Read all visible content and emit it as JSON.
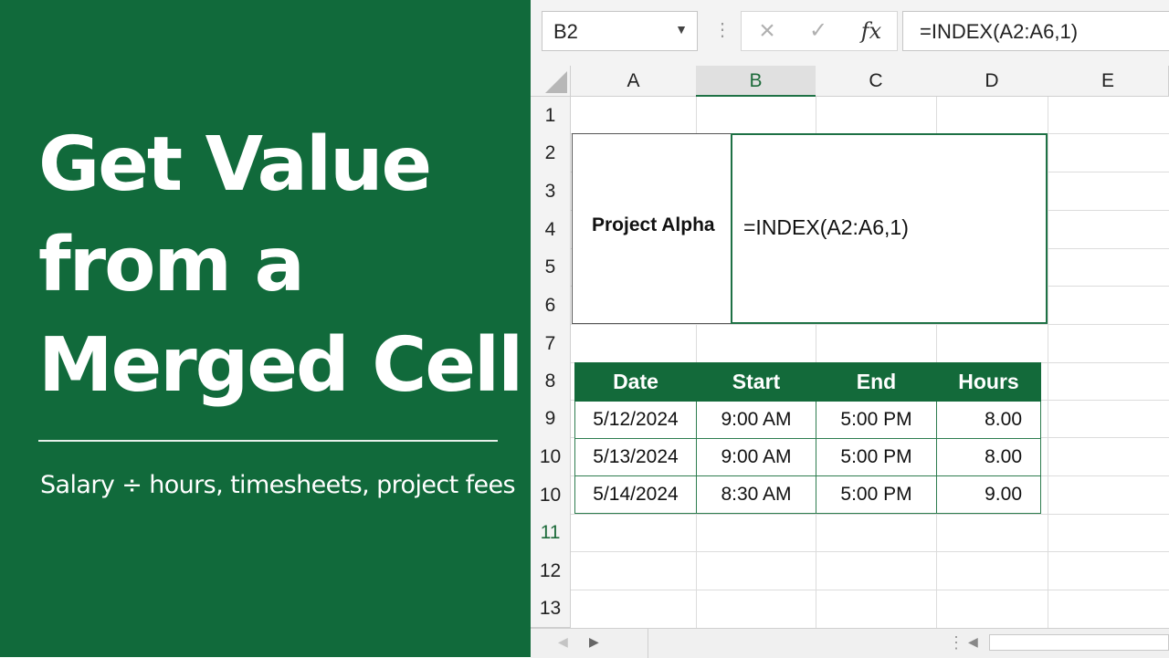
{
  "promo": {
    "title_lines": [
      "Get Value",
      "from a",
      "Merged Cell"
    ],
    "subtitle": "Salary ÷ hours, timesheets, project fees",
    "background_color": "#116a3b"
  },
  "formula_bar": {
    "name_box": "B2",
    "cancel_icon": "×",
    "enter_icon": "✓",
    "fx_label": "fx",
    "formula": "=INDEX(A2:A6,1)"
  },
  "sheet": {
    "columns": [
      "A",
      "B",
      "C",
      "D",
      "E"
    ],
    "selected_column": "B",
    "rows": [
      "1",
      "2",
      "3",
      "4",
      "5",
      "6",
      "7",
      "8",
      "9",
      "10",
      "10",
      "11",
      "12",
      "13"
    ],
    "merged_a": {
      "range": "A2:A6",
      "value": "Project Alpha"
    },
    "merged_b": {
      "range": "B2:D6",
      "value": "=INDEX(A2:A6,1)"
    },
    "table": {
      "headers": [
        "Date",
        "Start",
        "End",
        "Hours"
      ],
      "rows": [
        [
          "5/12/2024",
          "9:00 AM",
          "5:00 PM",
          "8.00"
        ],
        [
          "5/13/2024",
          "9:00 AM",
          "5:00 PM",
          "8.00"
        ],
        [
          "5/14/2024",
          "8:30 AM",
          "5:00 PM",
          "9.00"
        ]
      ],
      "header_color": "#136a3a"
    }
  },
  "accent_color": "#1e7145"
}
